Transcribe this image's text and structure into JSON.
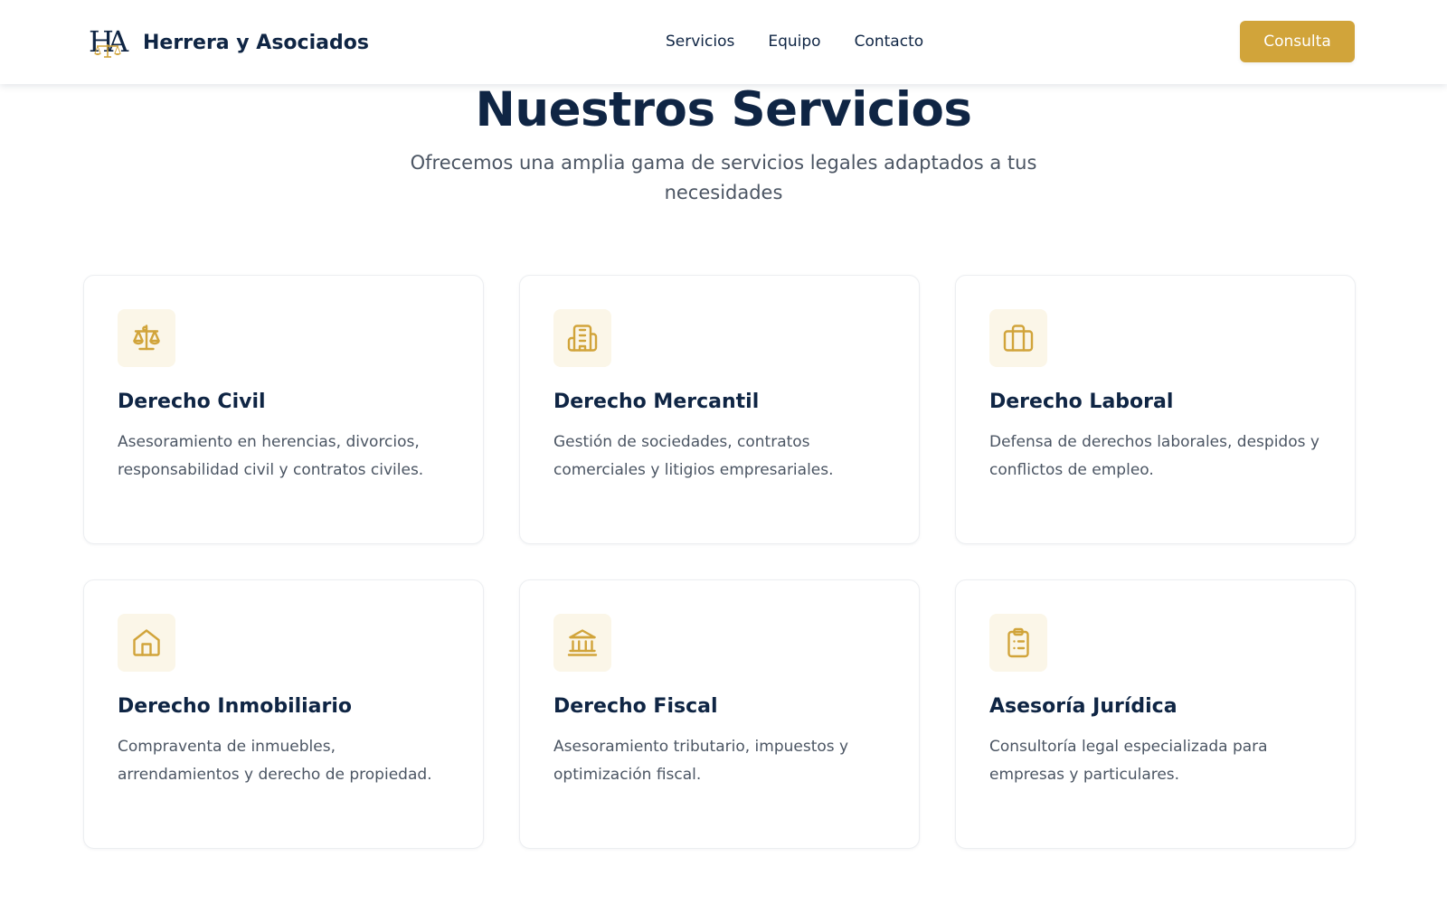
{
  "header": {
    "logo_icon": "scales-monogram-logo",
    "brand_name": "Herrera y Asociados",
    "nav": [
      {
        "label": "Servicios"
      },
      {
        "label": "Equipo"
      },
      {
        "label": "Contacto"
      }
    ],
    "cta_label": "Consulta"
  },
  "services": {
    "title": "Nuestros Servicios",
    "subtitle": "Ofrecemos una amplia gama de servicios legales adaptados a tus necesidades",
    "cards": [
      {
        "icon": "scales-icon",
        "title": "Derecho Civil",
        "description": "Asesoramiento en herencias, divorcios, responsabilidad civil y contratos civiles."
      },
      {
        "icon": "building-icon",
        "title": "Derecho Mercantil",
        "description": "Gestión de sociedades, contratos comerciales y litigios empresariales."
      },
      {
        "icon": "briefcase-icon",
        "title": "Derecho Laboral",
        "description": "Defensa de derechos laborales, despidos y conflictos de empleo."
      },
      {
        "icon": "house-icon",
        "title": "Derecho Inmobiliario",
        "description": "Compraventa de inmuebles, arrendamientos y derecho de propiedad."
      },
      {
        "icon": "bank-icon",
        "title": "Derecho Fiscal",
        "description": "Asesoramiento tributario, impuestos y optimización fiscal."
      },
      {
        "icon": "clipboard-icon",
        "title": "Asesoría Jurídica",
        "description": "Consultoría legal especializada para empresas y particulares."
      }
    ]
  },
  "colors": {
    "navy": "#0f2544",
    "gold": "#d1a43a",
    "icon_bg": "#fbf6e8",
    "body_text": "#4b5563"
  }
}
